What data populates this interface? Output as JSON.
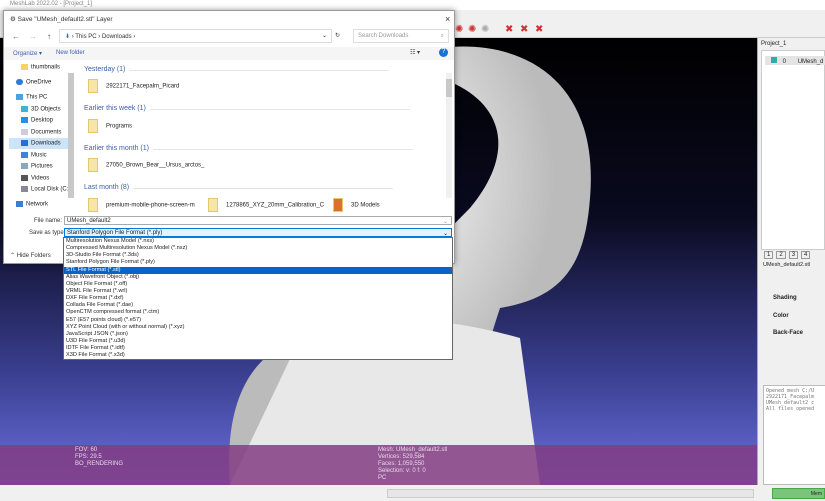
{
  "app": {
    "title": "MeshLab 2022.02 - [Project_1]"
  },
  "viewport": {
    "info_left": [
      "FOV: 60",
      "FPS:   29.5",
      "BO_RENDERING"
    ],
    "info_right": [
      "Mesh: UMesh_default2.stl",
      "Vertices: 529,584",
      "Faces: 1,059,550",
      "Selection: v: 0 f: 0",
      "PC"
    ]
  },
  "right_panel": {
    "project": "Project_1",
    "layer_index": "0",
    "layer_name": "UMesh_d",
    "view_buttons": [
      "1",
      "2",
      "3",
      "4"
    ],
    "mesh_label": "UMesh_default2.stl",
    "props": [
      "Shading",
      "Color",
      "Back-Face"
    ],
    "log": [
      "Opened mesh C:/U",
      "2922171_Facepalm",
      "UMesh_default2 c",
      "All files opened"
    ]
  },
  "dialog": {
    "title": "Save \"UMesh_default2.stl\" Layer",
    "breadcrumb": [
      "This PC",
      "Downloads"
    ],
    "search_placeholder": "Search Downloads",
    "organize": "Organize ▾",
    "new_folder": "New folder",
    "sidebar": [
      "thumbnails",
      "OneDrive",
      "This PC",
      "3D Objects",
      "Desktop",
      "Documents",
      "Downloads",
      "Music",
      "Pictures",
      "Videos",
      "Local Disk (C:)",
      "Network"
    ],
    "groups": [
      {
        "label": "Yesterday (1)",
        "files": [
          "2922171_Facepalm_Picard"
        ]
      },
      {
        "label": "Earlier this week (1)",
        "files": [
          "Programs"
        ]
      },
      {
        "label": "Earlier this month (1)",
        "files": [
          "27050_Brown_Bear__Ursus_arctos_"
        ]
      },
      {
        "label": "Last month (8)",
        "files": [
          "premium-mobile-phone-screen-m",
          "1278865_XYZ_20mm_Calibration_C",
          "3D Models"
        ]
      }
    ],
    "file_name_label": "File name:",
    "file_name": "UMesh_default2",
    "save_type_label": "Save as type:",
    "save_type": "Stanford Polygon File Format (*.ply)",
    "hide_folders": "Hide Folders",
    "type_options": [
      "Multiresolution Nexus Model (*.nxs)",
      "Compressed Multiresolution Nexus Model (*.nxz)",
      "3D-Studio File Format (*.3ds)",
      "Stanford Polygon File Format (*.ply)",
      "STL File Format (*.stl)",
      "Alias Wavefront Object (*.obj)",
      "Object File Format (*.off)",
      "VRML File Format (*.wrl)",
      "DXF File Format (*.dxf)",
      "Collada File Format (*.dae)",
      "OpenCTM compressed format (*.ctm)",
      "E57 (E57 points cloud) (*.e57)",
      "XYZ Point Cloud (with or without normal) (*.xyz)",
      "JavaScript JSON (*.json)",
      "U3D File Format (*.u3d)",
      "IDTF File Format (*.idtf)",
      "X3D File Format (*.x3d)"
    ],
    "selected_option": 4
  },
  "status": {
    "button": "Mem"
  }
}
